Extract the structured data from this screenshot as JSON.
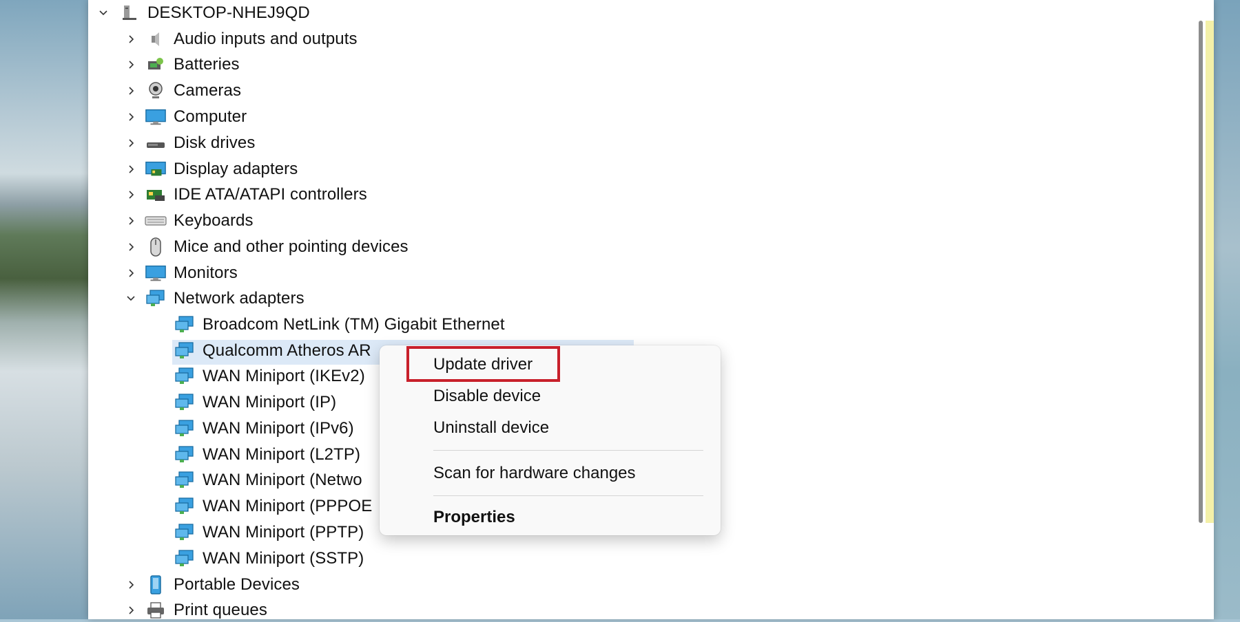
{
  "tree": {
    "root": "DESKTOP-NHEJ9QD",
    "categories": [
      {
        "label": "Audio inputs and outputs",
        "icon": "speaker-icon"
      },
      {
        "label": "Batteries",
        "icon": "battery-icon"
      },
      {
        "label": "Cameras",
        "icon": "camera-icon"
      },
      {
        "label": "Computer",
        "icon": "computer-icon"
      },
      {
        "label": "Disk drives",
        "icon": "disk-drive-icon"
      },
      {
        "label": "Display adapters",
        "icon": "display-adapter-icon"
      },
      {
        "label": "IDE ATA/ATAPI controllers",
        "icon": "ide-controller-icon"
      },
      {
        "label": "Keyboards",
        "icon": "keyboard-icon"
      },
      {
        "label": "Mice and other pointing devices",
        "icon": "mouse-icon"
      },
      {
        "label": "Monitors",
        "icon": "monitor-icon"
      },
      {
        "label": "Network adapters",
        "icon": "network-adapter-icon"
      }
    ],
    "network_children": [
      "Broadcom NetLink (TM) Gigabit Ethernet",
      "Qualcomm Atheros AR",
      "WAN Miniport (IKEv2)",
      "WAN Miniport (IP)",
      "WAN Miniport (IPv6)",
      "WAN Miniport (L2TP)",
      "WAN Miniport (Netwo",
      "WAN Miniport (PPPOE",
      "WAN Miniport (PPTP)",
      "WAN Miniport (SSTP)"
    ],
    "after": [
      {
        "label": "Portable Devices",
        "icon": "portable-device-icon"
      },
      {
        "label": "Print queues",
        "icon": "printer-icon"
      }
    ]
  },
  "context_menu": {
    "update_driver": "Update driver",
    "disable_device": "Disable device",
    "uninstall_device": "Uninstall device",
    "scan_hardware": "Scan for hardware changes",
    "properties": "Properties"
  },
  "colors": {
    "highlight_border": "#c8202b",
    "selection_bg": "#dce9f7",
    "network_icon": "#1e88c8"
  }
}
